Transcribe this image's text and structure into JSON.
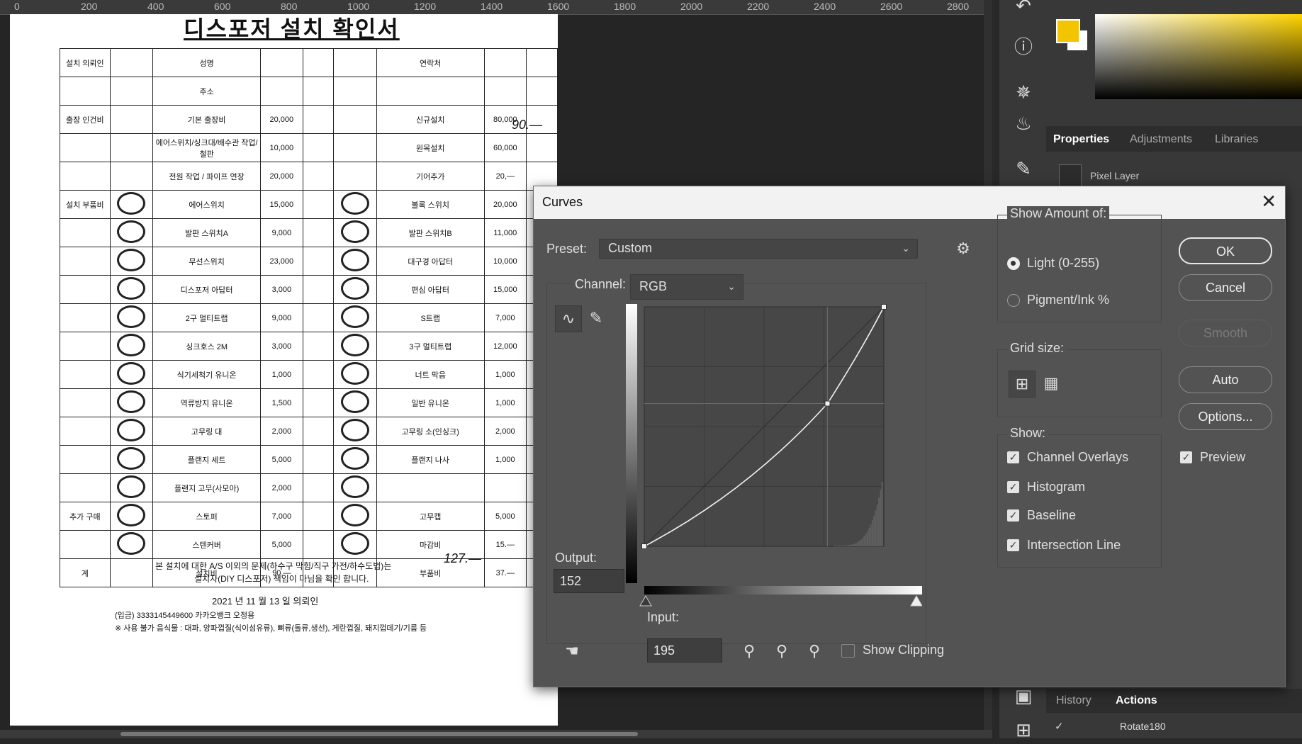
{
  "ruler": {
    "ticks": [
      "0",
      "200",
      "400",
      "600",
      "800",
      "1000",
      "1200",
      "1400",
      "1600",
      "1800",
      "2000",
      "2200",
      "2400",
      "2600",
      "2800"
    ]
  },
  "document": {
    "title": "디스포저 설치 확인서",
    "rows": [
      [
        "설치 의뢰인",
        "성명",
        "",
        "연락처",
        ""
      ],
      [
        "",
        "주소",
        "",
        "",
        ""
      ],
      [
        "출장 인건비",
        "기본 출장비",
        "20,000",
        "신규설치",
        "80,000"
      ],
      [
        "",
        "에어스위치/싱크대/배수관 작업/철판",
        "10,000",
        "원목설치",
        "60,000"
      ],
      [
        "",
        "전원 작업 / 파이프 연장",
        "20,000",
        "기어추가",
        "20,—"
      ],
      [
        "설치 부품비",
        "에어스위치",
        "15,000",
        "볼록 스위치",
        "20,000"
      ],
      [
        "",
        "발판 스위치A",
        "9,000",
        "발판 스위치B",
        "11,000"
      ],
      [
        "",
        "무선스위치",
        "23,000",
        "대구경 아답터",
        "10,000"
      ],
      [
        "",
        "디스포저 아답터",
        "3,000",
        "편심 아답터",
        "15,000"
      ],
      [
        "",
        "2구 멀티트랩",
        "9,000",
        "S트랩",
        "7,000"
      ],
      [
        "",
        "싱크호스 2M",
        "3,000",
        "3구 멀티트랩",
        "12,000"
      ],
      [
        "",
        "식기세척기 유니온",
        "1,000",
        "너트 막음",
        "1,000"
      ],
      [
        "",
        "역류방지 유니온",
        "1,500",
        "일반 유니온",
        "1,000"
      ],
      [
        "",
        "고무링 대",
        "2,000",
        "고무링 소(인싱크)",
        "2,000"
      ],
      [
        "",
        "플랜지 세트",
        "5,000",
        "플랜지 나사",
        "1,000"
      ],
      [
        "",
        "플랜지 고무(사모아)",
        "2,000",
        "",
        ""
      ],
      [
        "추가 구매",
        "스토퍼",
        "7,000",
        "고무캡",
        "5,000"
      ],
      [
        "",
        "스텐커버",
        "5,000",
        "마감비",
        "15.—"
      ],
      [
        "계",
        "설치비",
        "90.—",
        "부품비",
        "37.—"
      ]
    ],
    "side_note": "90.—",
    "total_note": "127.—",
    "footer1": "본 설치에 대한 A/S 이외의 문제(하수구 막힘/직구 가전/하수도법)는",
    "footer2": "설치자(DIY 디스포저) 책임이 마님을 확인 합니다.",
    "date": "2021 년 11 월 13 일        의뢰인",
    "account": "(입금) 3333145449600 카카오뱅크 오정용",
    "caution": "※ 사용 불가 음식물 : 대파, 양파껍질(식이섬유류), 뼈류(돌류,생선), 게란껍질, 돼지껍데기/기름 등"
  },
  "right_panel": {
    "tabs": [
      "Properties",
      "Adjustments",
      "Libraries"
    ],
    "layer_type": "Pixel Layer",
    "bottom_tabs": [
      "History",
      "Actions"
    ],
    "action_item": "Rotate180",
    "fg_color": "#f3c400",
    "bg_color": "#ffffff"
  },
  "curves": {
    "title": "Curves",
    "preset_label": "Preset:",
    "preset_value": "Custom",
    "channel_label": "Channel:",
    "channel_value": "RGB",
    "output_label": "Output:",
    "output_value": "152",
    "input_label": "Input:",
    "input_value": "195",
    "show_clipping": "Show Clipping",
    "show_amount": {
      "heading": "Show Amount of:",
      "light": "Light  (0-255)",
      "pigment": "Pigment/Ink %",
      "selected": "light"
    },
    "grid_size": "Grid size:",
    "show": {
      "heading": "Show:",
      "items": [
        "Channel Overlays",
        "Histogram",
        "Baseline",
        "Intersection Line"
      ]
    },
    "buttons": {
      "ok": "OK",
      "cancel": "Cancel",
      "smooth": "Smooth",
      "auto": "Auto",
      "options": "Options..."
    },
    "preview": "Preview",
    "curve_points": [
      [
        0,
        0
      ],
      [
        195,
        152
      ],
      [
        255,
        255
      ]
    ]
  }
}
